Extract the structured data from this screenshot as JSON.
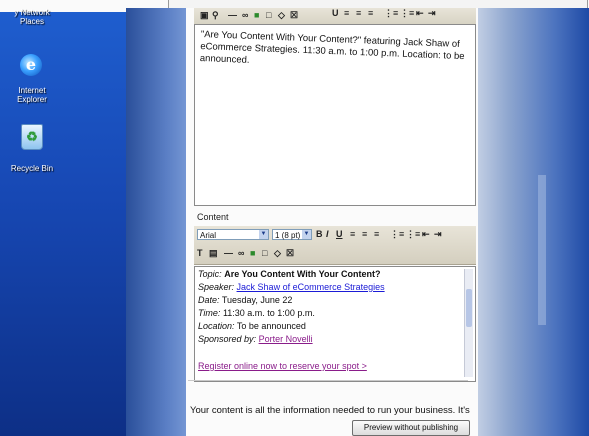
{
  "desktop": {
    "icons": [
      {
        "label_line1": "y Network",
        "label_line2": "Places"
      },
      {
        "label_line1": "Internet",
        "label_line2": "Explorer"
      },
      {
        "label_line1": "Recycle Bin",
        "label_line2": ""
      }
    ]
  },
  "summary_editor": {
    "text": "\"Are You Content With Your Content?\" featuring Jack Shaw of eCommerce Strategies. 11:30 a.m. to 1:00 p.m. Location: to be announced."
  },
  "content_editor": {
    "label": "Content",
    "font_select": "Arial",
    "size_select": "1 (8 pt)",
    "lines": {
      "topic_label": "Topic:",
      "topic_value": "Are You Content With Your Content?",
      "speaker_label": "Speaker:",
      "speaker_value": "Jack Shaw of eCommerce Strategies",
      "date_label": "Date:",
      "date_value": "Tuesday, June 22",
      "time_label": "Time:",
      "time_value": "11:30 a.m. to 1:00 p.m.",
      "location_label": "Location:",
      "location_value": "To be announced",
      "sponsor_label": "Sponsored by:",
      "sponsor_value": "Porter Novelli",
      "register_link": "Register online now to reserve your spot >"
    }
  },
  "footer": {
    "body_text": "Your content is all the information needed to run your business. It's",
    "preview_button": "Preview without publishing"
  },
  "colors": {
    "desktop_blue": "#1f5fd0",
    "link_blue": "#1b1bd6",
    "link_purple": "#8a1c8a"
  }
}
